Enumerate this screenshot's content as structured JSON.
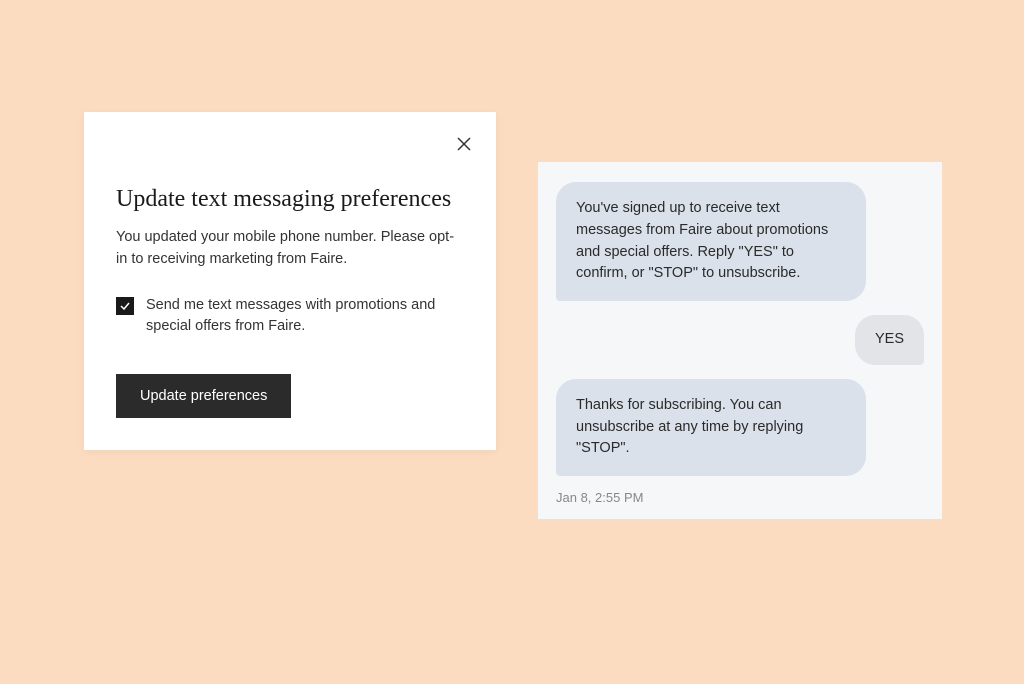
{
  "modal": {
    "title": "Update text messaging preferences",
    "description": "You updated your mobile phone number. Please opt-in to receiving marketing from Faire.",
    "checkbox": {
      "checked": true,
      "label": "Send me text messages with promotions and special offers from Faire."
    },
    "button_label": "Update preferences"
  },
  "chat": {
    "messages": [
      {
        "direction": "incoming",
        "text": "You've signed up to receive text messages from Faire about promotions and special offers. Reply \"YES\" to confirm, or \"STOP\" to unsubscribe."
      },
      {
        "direction": "outgoing",
        "text": "YES"
      },
      {
        "direction": "incoming",
        "text": "Thanks for subscribing. You can unsubscribe at any time by replying \"STOP\"."
      }
    ],
    "timestamp": "Jan 8, 2:55 PM"
  },
  "colors": {
    "background": "#fcdcc1",
    "modal_bg": "#ffffff",
    "chat_bg": "#f6f7f8",
    "bubble_incoming": "#dbe1ea",
    "bubble_outgoing": "#e2e4e7",
    "button_bg": "#2b2b2b",
    "checkbox_bg": "#1a1a1a"
  }
}
